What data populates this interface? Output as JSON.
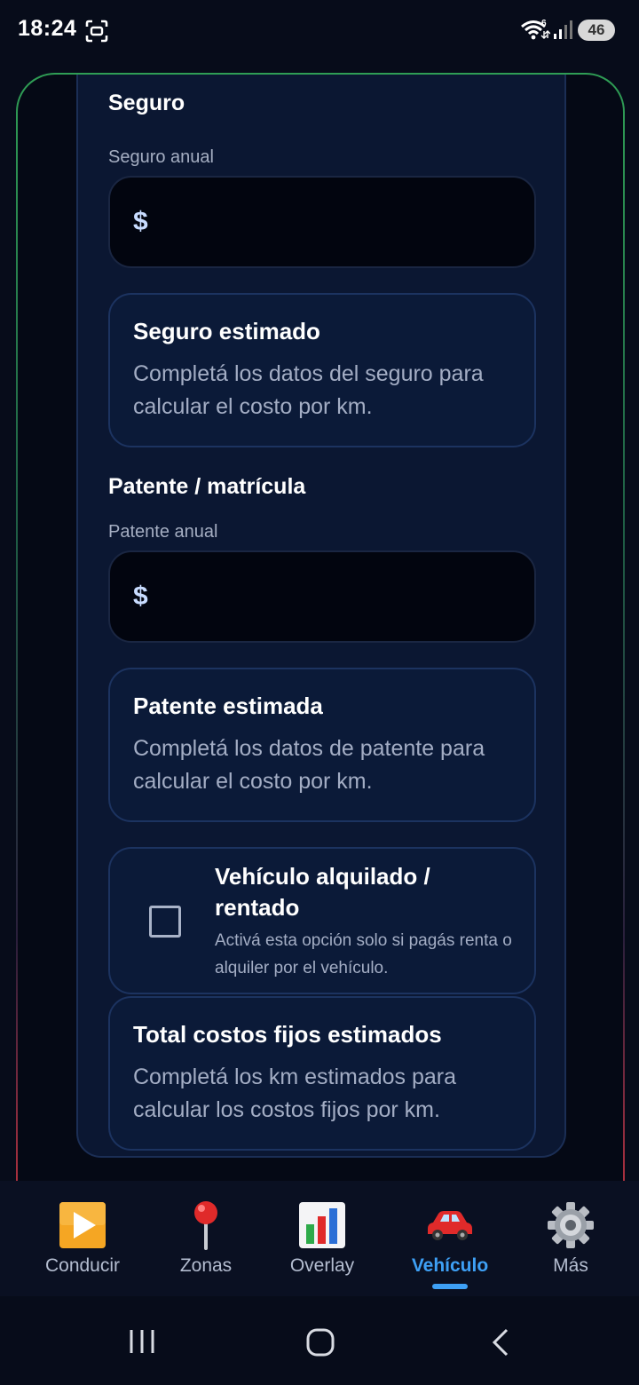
{
  "status_bar": {
    "time": "18:24",
    "battery": "46",
    "wifi_badge": "6"
  },
  "sections": {
    "seguro": {
      "title": "Seguro",
      "field_label": "Seguro anual",
      "currency": "$",
      "value": ""
    },
    "seguro_card": {
      "title": "Seguro estimado",
      "text": "Completá los datos del seguro para calcular el costo por km."
    },
    "patente": {
      "title": "Patente / matrícula",
      "field_label": "Patente anual",
      "currency": "$",
      "value": ""
    },
    "patente_card": {
      "title": "Patente estimada",
      "text": "Completá los datos de patente para calcular el costo por km."
    },
    "rent": {
      "title": "Vehículo alquilado / rentado",
      "description": "Activá esta opción solo si pagás renta o alquiler por el vehículo.",
      "checked": false
    },
    "total_card": {
      "title": "Total costos fijos estimados",
      "text": "Completá los km estimados para calcular los costos fijos por km."
    }
  },
  "bottom_nav": {
    "items": [
      {
        "label": "Conducir",
        "icon": "play-button-icon",
        "active": false
      },
      {
        "label": "Zonas",
        "icon": "pin-icon",
        "active": false
      },
      {
        "label": "Overlay",
        "icon": "bar-chart-icon",
        "active": false
      },
      {
        "label": "Vehículo",
        "icon": "car-icon",
        "active": true
      },
      {
        "label": "Más",
        "icon": "gear-icon",
        "active": false
      }
    ],
    "accent": "#3ea0f5"
  },
  "colors": {
    "background": "#070c1a",
    "panel": "#0b1732",
    "card": "#0b1a38",
    "frame_top": "#2f9e55",
    "frame_bottom": "#c2333f"
  }
}
